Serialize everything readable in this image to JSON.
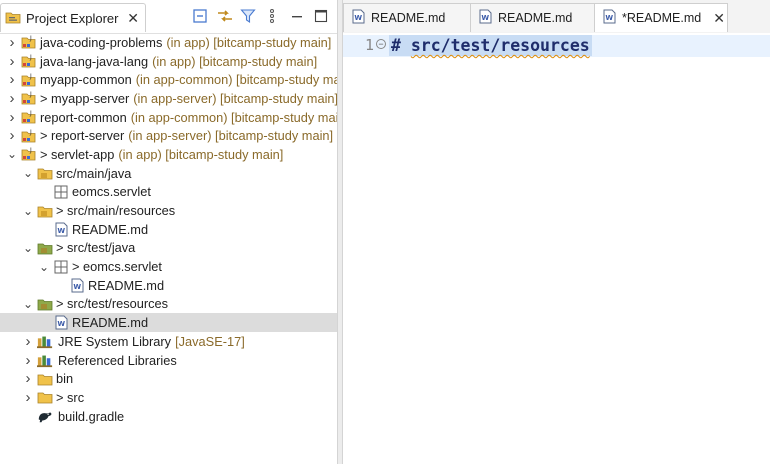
{
  "project_explorer": {
    "title": "Project Explorer",
    "close": "✕"
  },
  "tree": [
    {
      "name": "java-coding-problems",
      "dec": "(in app) [bitcamp-study main]",
      "level": 0,
      "twisty": ">",
      "icon": "project",
      "prefix": ""
    },
    {
      "name": "java-lang-java-lang",
      "dec": "(in app) [bitcamp-study main]",
      "level": 0,
      "twisty": ">",
      "icon": "project",
      "prefix": ""
    },
    {
      "name": "myapp-common",
      "dec": "(in app-common) [bitcamp-study main]",
      "level": 0,
      "twisty": ">",
      "icon": "project",
      "prefix": ""
    },
    {
      "name": "myapp-server",
      "dec": "(in app-server) [bitcamp-study main]",
      "level": 0,
      "twisty": ">",
      "icon": "project",
      "prefix": "> "
    },
    {
      "name": "report-common",
      "dec": "(in app-common) [bitcamp-study main]",
      "level": 0,
      "twisty": ">",
      "icon": "project",
      "prefix": ""
    },
    {
      "name": "report-server",
      "dec": "(in app-server) [bitcamp-study main]",
      "level": 0,
      "twisty": ">",
      "icon": "project",
      "prefix": "> "
    },
    {
      "name": "servlet-app",
      "dec": "(in app) [bitcamp-study main]",
      "level": 0,
      "twisty": "⌄",
      "icon": "project",
      "prefix": "> "
    },
    {
      "name": "src/main/java",
      "dec": "",
      "level": 1,
      "twisty": "⌄",
      "icon": "srcfolder",
      "prefix": ""
    },
    {
      "name": "eomcs.servlet",
      "dec": "",
      "level": 2,
      "twisty": "",
      "icon": "package",
      "prefix": ""
    },
    {
      "name": "src/main/resources",
      "dec": "",
      "level": 1,
      "twisty": "⌄",
      "icon": "srcfolder",
      "prefix": "> "
    },
    {
      "name": "README.md",
      "dec": "",
      "level": 2,
      "twisty": "",
      "icon": "md",
      "prefix": ""
    },
    {
      "name": "src/test/java",
      "dec": "",
      "level": 1,
      "twisty": "⌄",
      "icon": "testfolder",
      "prefix": "> "
    },
    {
      "name": "eomcs.servlet",
      "dec": "",
      "level": 2,
      "twisty": "⌄",
      "icon": "package",
      "prefix": "> "
    },
    {
      "name": "README.md",
      "dec": "",
      "level": 3,
      "twisty": "",
      "icon": "md",
      "prefix": ""
    },
    {
      "name": "src/test/resources",
      "dec": "",
      "level": 1,
      "twisty": "⌄",
      "icon": "testfolder",
      "prefix": "> "
    },
    {
      "name": "README.md",
      "dec": "",
      "level": 2,
      "twisty": "",
      "icon": "md",
      "prefix": "",
      "selected": true
    },
    {
      "name": "JRE System Library",
      "dec": "[JavaSE-17]",
      "level": 1,
      "twisty": ">",
      "icon": "library",
      "prefix": ""
    },
    {
      "name": "Referenced Libraries",
      "dec": "",
      "level": 1,
      "twisty": ">",
      "icon": "library",
      "prefix": ""
    },
    {
      "name": "bin",
      "dec": "",
      "level": 1,
      "twisty": ">",
      "icon": "folder",
      "prefix": ""
    },
    {
      "name": "src",
      "dec": "",
      "level": 1,
      "twisty": ">",
      "icon": "folder",
      "prefix": "> "
    },
    {
      "name": "build.gradle",
      "dec": "",
      "level": 1,
      "twisty": "",
      "icon": "gradle",
      "prefix": ""
    }
  ],
  "editor_tabs": [
    {
      "label": "README.md",
      "active": false
    },
    {
      "label": "README.md",
      "active": false
    },
    {
      "label": "*README.md",
      "active": true
    }
  ],
  "editor": {
    "line_number": "1",
    "fold": "−",
    "code_hash": "# ",
    "code_text": "src/test/resources"
  },
  "colors": {
    "accent": "#2a62c9",
    "decoration": "#8a6a2a",
    "selection": "#dcdcdc",
    "current_line": "#e8f2fe"
  }
}
